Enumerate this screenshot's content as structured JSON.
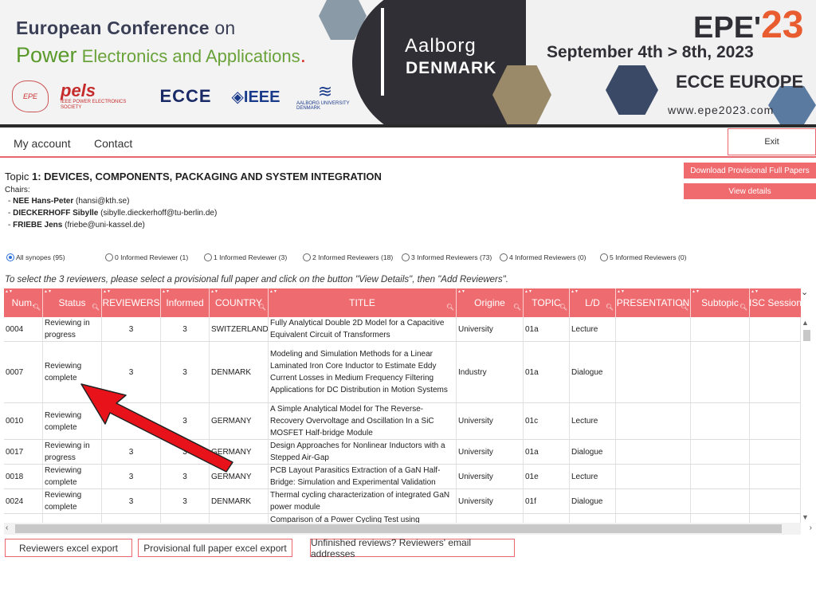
{
  "banner": {
    "title_line1_bold": "European Conference",
    "title_line1_rest": " on",
    "title_line2_power": "Power",
    "title_line2_rest": " Electronics and Applications",
    "city": "Aalborg",
    "country": "DENMARK",
    "event_prefix": "EPE'",
    "event_year": "23",
    "dates": "September 4th > 8th, 2023",
    "ecce_europe": "ECCE EUROPE",
    "url": "www.epe2023.com",
    "logos": {
      "epe": "EPE",
      "pels": "pels",
      "pels_sub": "IEEE POWER ELECTRONICS SOCIETY",
      "ecce": "ECCE",
      "ieee": "◈IEEE",
      "aau": "AALBORG UNIVERSITY DENMARK"
    }
  },
  "nav": {
    "my_account": "My account",
    "contact": "Contact",
    "exit": "Exit"
  },
  "topic": {
    "prefix": "Topic ",
    "number": "1",
    "title": ": DEVICES, COMPONENTS, PACKAGING AND SYSTEM INTEGRATION",
    "chairs_label": "Chairs:",
    "chairs": [
      {
        "name": "NEE Hans-Peter",
        "email": "(hansi@kth.se)"
      },
      {
        "name": "DIECKERHOFF Sibylle",
        "email": "(sibylle.dieckerhoff@tu-berlin.de)"
      },
      {
        "name": "FRIEBE Jens",
        "email": "(friebe@uni-kassel.de)"
      }
    ]
  },
  "actions": {
    "download": "Download Provisional Full Papers",
    "view_details": "View details"
  },
  "filters": [
    {
      "label": "All synopes (95)",
      "selected": true
    },
    {
      "label": "0 Informed Reviewer (1)",
      "selected": false
    },
    {
      "label": "1 Informed Reviewer (3)",
      "selected": false
    },
    {
      "label": "2 Informed Reviewers (18)",
      "selected": false
    },
    {
      "label": "3 Informed Reviewers (73)",
      "selected": false
    },
    {
      "label": "4 Informed Reviewers (0)",
      "selected": false
    },
    {
      "label": "5 Informed Reviewers (0)",
      "selected": false
    }
  ],
  "instruction": "To select the 3 reviewers, please select a provisional full paper and click on the button \"View Details\", then \"Add Reviewers\".",
  "table": {
    "columns": [
      "Num.",
      "Status",
      "REVIEWERS",
      "Informed",
      "COUNTRY",
      "TITLE",
      "Origine",
      "TOPIC",
      "L/D",
      "PRESENTATION",
      "Subtopic",
      "ISC Session"
    ],
    "rows": [
      {
        "num": "0004",
        "status": "Reviewing in progress",
        "reviewers": "3",
        "informed": "3",
        "country": "SWITZERLAND",
        "title": "Fully Analytical Double 2D Model for a Capacitive Equivalent Circuit of Transformers",
        "origine": "University",
        "topic": "01a",
        "ld": "Lecture"
      },
      {
        "num": "0007",
        "status": "Reviewing complete",
        "reviewers": "3",
        "informed": "3",
        "country": "DENMARK",
        "title": "Modeling and Simulation Methods for a Linear Laminated Iron Core Inductor to Estimate Eddy Current Losses in Medium Frequency Filtering Applications for DC Distribution in Motion Systems",
        "origine": "Industry",
        "topic": "01a",
        "ld": "Dialogue"
      },
      {
        "num": "0010",
        "status": "Reviewing complete",
        "reviewers": "3",
        "informed": "3",
        "country": "GERMANY",
        "title": "A Simple Analytical Model for The Reverse-Recovery Overvoltage and Oscillation In a SiC MOSFET Half-bridge Module",
        "origine": "University",
        "topic": "01c",
        "ld": "Lecture"
      },
      {
        "num": "0017",
        "status": "Reviewing in progress",
        "reviewers": "3",
        "informed": "3",
        "country": "GERMANY",
        "title": "Design Approaches for Nonlinear Inductors with a Stepped Air-Gap",
        "origine": "University",
        "topic": "01a",
        "ld": "Dialogue"
      },
      {
        "num": "0018",
        "status": "Reviewing complete",
        "reviewers": "3",
        "informed": "3",
        "country": "GERMANY",
        "title": "PCB Layout Parasitics Extraction of a GaN Half-Bridge: Simulation and Experimental Validation",
        "origine": "University",
        "topic": "01e",
        "ld": "Lecture"
      },
      {
        "num": "0024",
        "status": "Reviewing complete",
        "reviewers": "3",
        "informed": "3",
        "country": "DENMARK",
        "title": "Thermal cycling characterization of integrated GaN power module",
        "origine": "University",
        "topic": "01f",
        "ld": "Dialogue"
      },
      {
        "num": "",
        "status": "",
        "reviewers": "",
        "informed": "",
        "country": "",
        "title": "Comparison of a Power Cycling Test using Repetitive",
        "origine": "",
        "topic": "",
        "ld": ""
      }
    ]
  },
  "bottom_buttons": {
    "reviewers_export": "Reviewers excel export",
    "paper_export": "Provisional full paper excel export",
    "unfinished": "Unfinished reviews? Reviewers' email addresses"
  },
  "colors": {
    "accent": "#ee6b6f",
    "annotation_arrow": "#e8121a"
  }
}
